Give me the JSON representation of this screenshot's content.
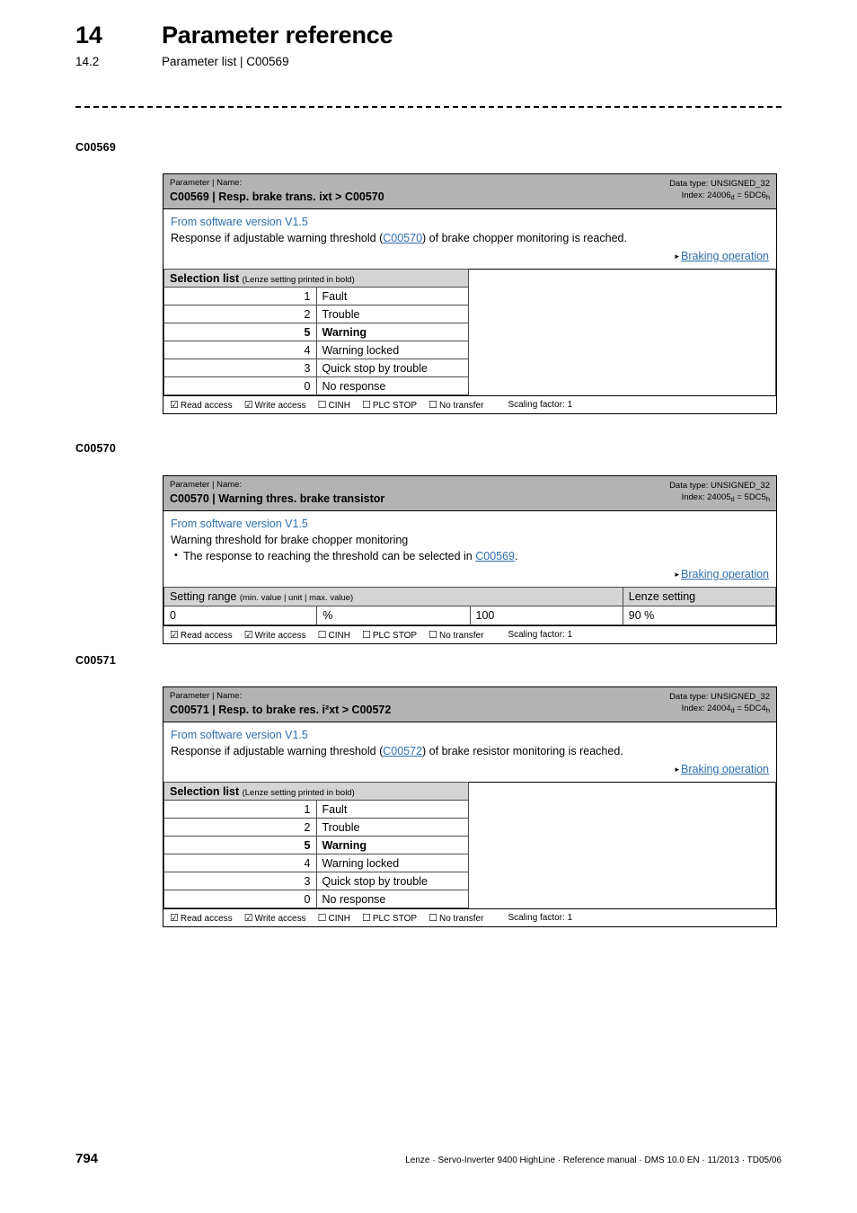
{
  "header": {
    "chapter_number": "14",
    "chapter_title": "Parameter reference",
    "section_number": "14.2",
    "section_title": "Parameter list | C00569"
  },
  "footer": {
    "page_number": "794",
    "source_line": "Lenze · Servo-Inverter 9400 HighLine · Reference manual · DMS 10.0 EN · 11/2013 · TD05/06"
  },
  "labels": {
    "kicker": "Parameter | Name:",
    "selection_list_title": "Selection list",
    "selection_list_note": "(Lenze setting printed in bold)",
    "setting_range_title": "Setting range",
    "setting_range_note": "(min. value | unit | max. value)",
    "lenze_setting_title": "Lenze setting",
    "scaling_factor": "Scaling factor: 1",
    "checked_box": "☑",
    "unchecked_box": "☐",
    "triangle": "▸",
    "flags": {
      "read_access": "Read access",
      "write_access": "Write access",
      "cinh": "CINH",
      "plc_stop": "PLC STOP",
      "no_transfer": "No transfer"
    }
  },
  "colors": {
    "header_bar": "#b3b3b3",
    "table_header": "#d4d4d4",
    "link_blue": "#2c6fae"
  },
  "blocks": [
    {
      "margin_label": "C00569",
      "name": "C00569 | Resp. brake trans. ixt > C00570",
      "data_type": "Data type: UNSIGNED_32",
      "index_prefix": "Index: 24006",
      "index_sub1": "d",
      "index_mid": " = 5DC6",
      "index_sub2": "h",
      "software_version": "From software version V1.5",
      "description_pre": "Response if adjustable warning threshold (",
      "description_link": "C00570",
      "description_post": ") of brake chopper monitoring is reached.",
      "crossref": "Braking operation",
      "table_type": "selection",
      "rows": [
        {
          "code": "1",
          "label": "Fault",
          "bold": false
        },
        {
          "code": "2",
          "label": "Trouble",
          "bold": false
        },
        {
          "code": "5",
          "label": "Warning",
          "bold": true
        },
        {
          "code": "4",
          "label": "Warning locked",
          "bold": false
        },
        {
          "code": "3",
          "label": "Quick stop by trouble",
          "bold": false
        },
        {
          "code": "0",
          "label": "No response",
          "bold": false
        }
      ]
    },
    {
      "margin_label": "C00570",
      "name": "C00570 | Warning thres. brake transistor",
      "data_type": "Data type: UNSIGNED_32",
      "index_prefix": "Index: 24005",
      "index_sub1": "d",
      "index_mid": " = 5DC5",
      "index_sub2": "h",
      "software_version": "From software version V1.5",
      "description_plain": "Warning threshold for brake chopper monitoring",
      "bullet_pre": "The response to reaching the threshold can be selected in ",
      "bullet_link": "C00569",
      "bullet_post": ".",
      "crossref": "Braking operation",
      "table_type": "range",
      "range": {
        "min": "0",
        "unit": "%",
        "max": "100",
        "lenze_setting": "90 %"
      }
    },
    {
      "margin_label": "C00571",
      "name": "C00571 | Resp. to brake res. i²xt > C00572",
      "data_type": "Data type: UNSIGNED_32",
      "index_prefix": "Index: 24004",
      "index_sub1": "d",
      "index_mid": " = 5DC4",
      "index_sub2": "h",
      "software_version": "From software version V1.5",
      "description_pre": "Response if adjustable warning threshold (",
      "description_link": "C00572",
      "description_post": ") of brake resistor monitoring is reached.",
      "crossref": "Braking operation",
      "table_type": "selection",
      "rows": [
        {
          "code": "1",
          "label": "Fault",
          "bold": false
        },
        {
          "code": "2",
          "label": "Trouble",
          "bold": false
        },
        {
          "code": "5",
          "label": "Warning",
          "bold": true
        },
        {
          "code": "4",
          "label": "Warning locked",
          "bold": false
        },
        {
          "code": "3",
          "label": "Quick stop by trouble",
          "bold": false
        },
        {
          "code": "0",
          "label": "No response",
          "bold": false
        }
      ]
    }
  ]
}
